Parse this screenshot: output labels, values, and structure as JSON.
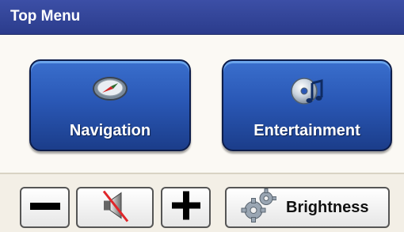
{
  "titlebar": {
    "title": "Top Menu"
  },
  "menu": {
    "navigation_label": "Navigation",
    "entertainment_label": "Entertainment"
  },
  "bottom_bar": {
    "brightness_label": "Brightness"
  },
  "icons": {
    "navigation": "compass-icon",
    "entertainment": "music-cd-icon",
    "volume_down": "minus-icon",
    "mute": "speaker-muted-icon",
    "volume_up": "plus-icon",
    "brightness": "gears-icon"
  },
  "colors": {
    "titlebar": "#2f3f92",
    "big_button": "#2a58b6",
    "accent_red": "#e0262a"
  }
}
